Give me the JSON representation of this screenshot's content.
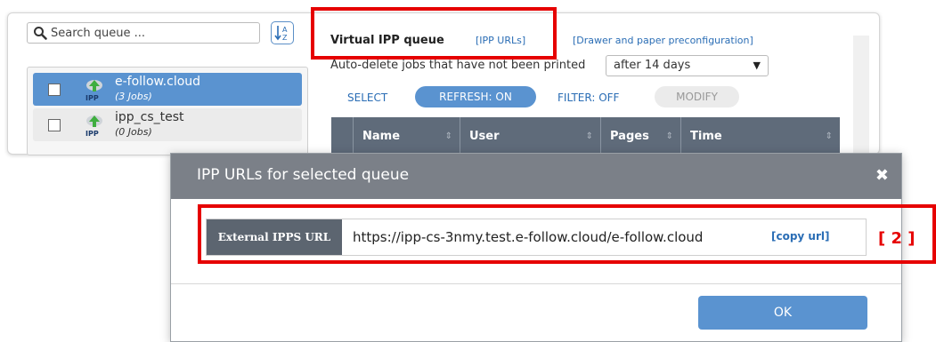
{
  "search": {
    "placeholder": "Search queue ..."
  },
  "queues": [
    {
      "name": "e-follow.cloud",
      "jobs": "(3 Jobs)",
      "icon": "ipp-printer-icon",
      "selected": true
    },
    {
      "name": "ipp_cs_test",
      "jobs": "(0 Jobs)",
      "icon": "ipp-printer-icon",
      "selected": false
    }
  ],
  "ipp_badge": "IPP",
  "panel": {
    "title": "Virtual IPP queue",
    "ipp_urls_link": "[IPP URLs]",
    "drawer_link": "[Drawer and paper preconfiguration]",
    "autodelete_label": "Auto-delete jobs that have not been printed",
    "autodelete_value": "after 14 days"
  },
  "toolbar": {
    "select": "SELECT",
    "refresh": "REFRESH: ON",
    "filter": "FILTER: OFF",
    "modify": "MODIFY"
  },
  "table": {
    "columns": [
      "Name",
      "User",
      "Pages",
      "Time"
    ]
  },
  "dialog": {
    "title": "IPP URLs for selected queue",
    "url_label": "External IPPS URL",
    "url_value": "https://ipp-cs-3nmy.test.e-follow.cloud/e-follow.cloud",
    "copy_url": "[copy url]",
    "ok": "OK"
  },
  "annotation": {
    "marker": "[ 2 ]",
    "color": "#e60000"
  },
  "colors": {
    "accent": "#5a93d0",
    "header": "#7b8088"
  }
}
